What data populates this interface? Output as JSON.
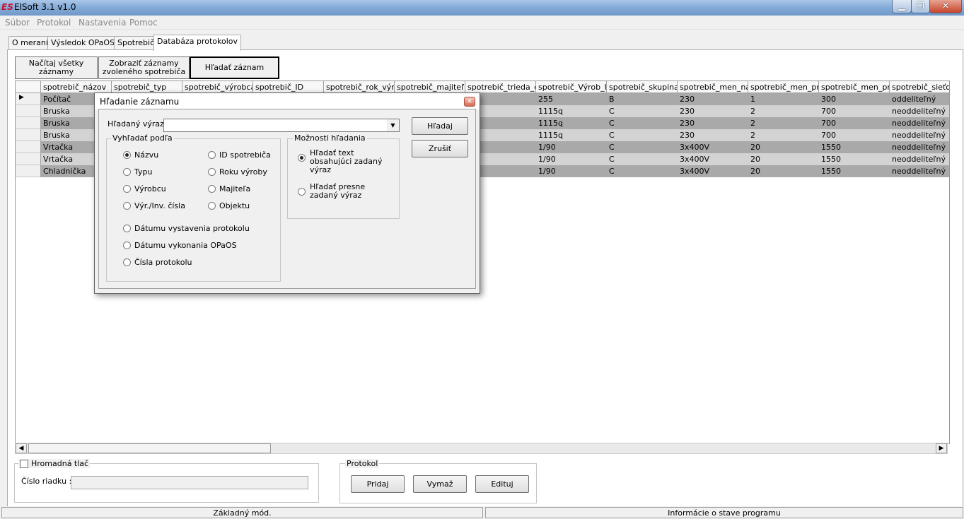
{
  "window": {
    "title": "ElSoft 3.1 v1.0",
    "logo_text": "ES",
    "min_glyph": "▁",
    "max_glyph": "❐",
    "close_glyph": "✕"
  },
  "menu": [
    "Súbor",
    "Protokol",
    "Nastavenia",
    "Pomoc"
  ],
  "tabs": [
    {
      "label": "O meraní",
      "active": false
    },
    {
      "label": "Výsledok OPaOS",
      "active": false
    },
    {
      "label": "Spotrebič",
      "active": false
    },
    {
      "label": "Databáza protokolov",
      "active": true
    }
  ],
  "toolbar": {
    "load_all": "Načítaj všetky záznamy",
    "show_selected": "Zobraziť záznamy zvoleného spotrebiča",
    "search_record": "Hľadať záznam"
  },
  "grid": {
    "columns": [
      "spotrebič_názov",
      "spotrebič_typ",
      "spotrebič_výrobca",
      "spotrebič_ID",
      "spotrebič_rok_výro",
      "spotrebič_majiteľ",
      "spotrebič_trieda_o",
      "spotrebič_Výrob_l",
      "spotrebič_skupina",
      "spotrebič_men_na",
      "spotrebič_men_pr",
      "spotrebič_men_prí",
      "spotrebič_sieťov"
    ],
    "current_row_marker": "▶",
    "rows": [
      [
        "Počítač",
        "",
        "",
        "",
        "",
        "",
        "",
        "255",
        "B",
        "230",
        "1",
        "300",
        "oddeliteľný"
      ],
      [
        "Bruska",
        "",
        "",
        "",
        "",
        "",
        "",
        "1115q",
        "C",
        "230",
        "2",
        "700",
        "neoddeliteľný"
      ],
      [
        "Bruska",
        "",
        "",
        "",
        "",
        "",
        "",
        "1115q",
        "C",
        "230",
        "2",
        "700",
        "neoddeliteľný"
      ],
      [
        "Bruska",
        "",
        "",
        "",
        "",
        "",
        "",
        "1115q",
        "C",
        "230",
        "2",
        "700",
        "neoddeliteľný"
      ],
      [
        "Vrtačka",
        "",
        "",
        "",
        "",
        "",
        "",
        "1/90",
        "C",
        "3x400V",
        "20",
        "1550",
        "neoddeliteľný"
      ],
      [
        "Vrtačka",
        "",
        "",
        "",
        "",
        "",
        "",
        "1/90",
        "C",
        "3x400V",
        "20",
        "1550",
        "neoddeliteľný"
      ],
      [
        "Chladnička",
        "",
        "",
        "",
        "",
        "",
        "",
        "1/90",
        "C",
        "3x400V",
        "20",
        "1550",
        "neoddeliteľný"
      ]
    ]
  },
  "scroll": {
    "left_arrow": "◀",
    "right_arrow": "▶"
  },
  "bulk_print": {
    "checkbox_label": "Hromadná tlač",
    "row_number_label": "Číslo riadku :",
    "row_number_value": ""
  },
  "protocol": {
    "group_label": "Protokol",
    "add": "Pridaj",
    "delete": "Vymaž",
    "edit": "Edituj"
  },
  "status": {
    "mode": "Základný mód.",
    "info": "Informácie o stave programu"
  },
  "dialog": {
    "title": "Hľadanie záznamu",
    "close_glyph": "✕",
    "search_label": "Hľadaný výraz:",
    "search_value": "",
    "dropdown_glyph": "▼",
    "search_button": "Hľadaj",
    "cancel_button": "Zrušiť",
    "search_by_group": "Vyhľadať podľa",
    "search_by": [
      {
        "label": "Názvu",
        "checked": true
      },
      {
        "label": "ID spotrebiča",
        "checked": false
      },
      {
        "label": "Typu",
        "checked": false
      },
      {
        "label": "Roku výroby",
        "checked": false
      },
      {
        "label": "Výrobcu",
        "checked": false
      },
      {
        "label": "Majiteľa",
        "checked": false
      },
      {
        "label": "Výr./Inv. čísla",
        "checked": false
      },
      {
        "label": "Objektu",
        "checked": false
      },
      {
        "label": "Dátumu vystavenia protokolu",
        "checked": false
      },
      {
        "label": "Dátumu vykonania OPaOS",
        "checked": false
      },
      {
        "label": "Čísla protokolu",
        "checked": false
      }
    ],
    "options_group": "Možnosti hľadania",
    "options": [
      {
        "label": "Hľadať text obsahujúci zadaný výraz",
        "checked": true
      },
      {
        "label": "Hľadať presne zadaný výraz",
        "checked": false
      }
    ]
  }
}
